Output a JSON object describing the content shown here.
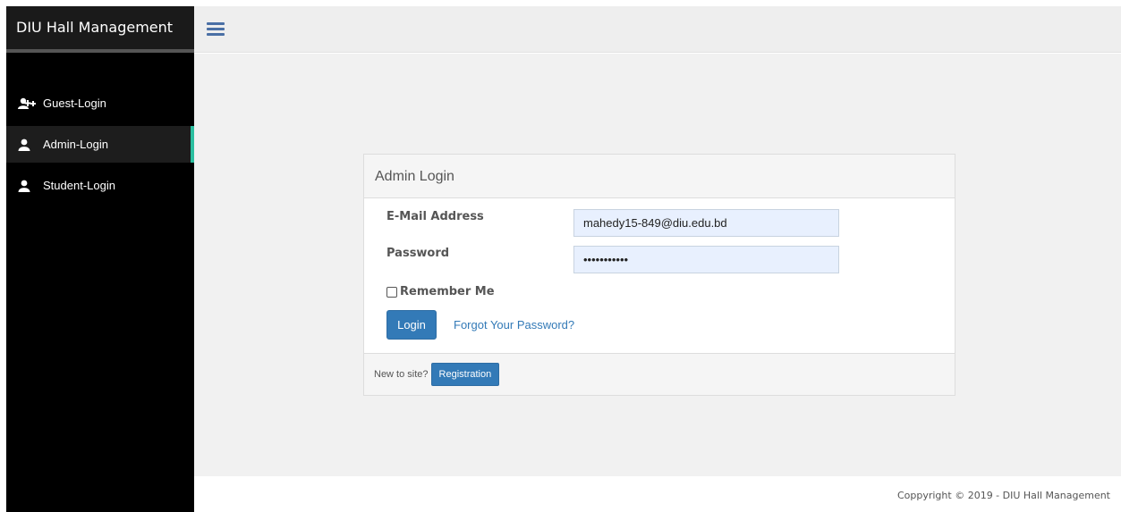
{
  "brand": {
    "title": "DIU Hall Management"
  },
  "sidebar": {
    "items": [
      {
        "label": "Guest-Login",
        "icon": "user-plus-icon"
      },
      {
        "label": "Admin-Login",
        "icon": "user-icon"
      },
      {
        "label": "Student-Login",
        "icon": "user-icon"
      }
    ]
  },
  "topbar": {
    "menu_icon": "hamburger-icon"
  },
  "login": {
    "heading": "Admin Login",
    "email_label": "E-Mail Address",
    "email_value": "mahedy15-849@diu.edu.bd",
    "password_label": "Password",
    "password_value": "•••••••••••",
    "remember_label": "Remember Me",
    "login_button": "Login",
    "forgot_link": "Forgot Your Password?",
    "new_site_text": "New to site?",
    "registration_button": "Registration"
  },
  "footer": {
    "copyright": "Coppyright © 2019 - DIU Hall Management"
  },
  "colors": {
    "accent": "#337ab7",
    "active_indicator": "#2bbfa0",
    "sidebar_bg": "#000000"
  }
}
